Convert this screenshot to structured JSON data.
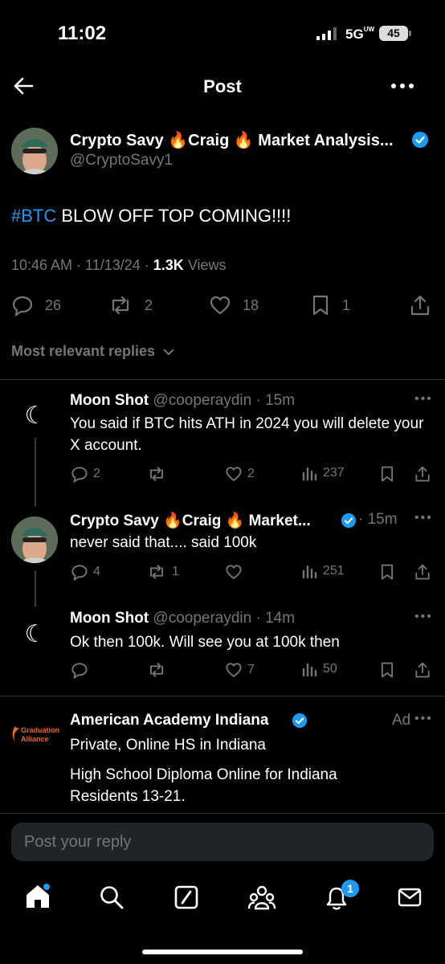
{
  "status_bar": {
    "time": "11:02",
    "network": "5G",
    "network_sub": "UW",
    "battery": "45"
  },
  "header": {
    "title": "Post"
  },
  "post": {
    "author_name": "Crypto Savy 🔥Craig 🔥 Market Analysis...",
    "author_handle": "@CryptoSavy1",
    "hashtag": "#BTC",
    "text": " BLOW OFF TOP COMING!!!!",
    "time": "10:46 AM · 11/13/24 · ",
    "views_count": "1.3K",
    "views_label": " Views",
    "replies": "26",
    "reposts": "2",
    "likes": "18",
    "bookmarks": "1"
  },
  "replies_filter": {
    "label": "Most relevant replies"
  },
  "replies": [
    {
      "name": "Moon Shot",
      "handle": " @cooperaydin",
      "time": " · 15m",
      "text": "You said if BTC hits ATH in 2024 you will delete your X account.",
      "reply_count": "2",
      "repost_count": "",
      "like_count": "2",
      "views": "237"
    },
    {
      "name": "Crypto Savy 🔥Craig 🔥 Market...",
      "handle": "",
      "time": " · 15m",
      "text": "never said that.... said 100k",
      "reply_count": "4",
      "repost_count": "1",
      "like_count": "",
      "views": "251"
    },
    {
      "name": "Moon Shot",
      "handle": " @cooperaydin",
      "time": " · 14m",
      "text": "Ok then 100k. Will see you at 100k then",
      "reply_count": "",
      "repost_count": "",
      "like_count": "7",
      "views": "50"
    }
  ],
  "ad": {
    "logo_line1": "Graduation",
    "logo_line2": "Alliance",
    "name": "American Academy Indiana",
    "ad_label": "Ad",
    "line1": "Private, Online HS in Indiana",
    "line2": "High School Diploma Online for Indiana Residents 13-21."
  },
  "reply_input": {
    "placeholder": "Post your reply"
  },
  "nav": {
    "notifications_badge": "1"
  },
  "colors": {
    "accent": "#1d9bf0",
    "muted": "#71767b",
    "background": "#000000"
  }
}
